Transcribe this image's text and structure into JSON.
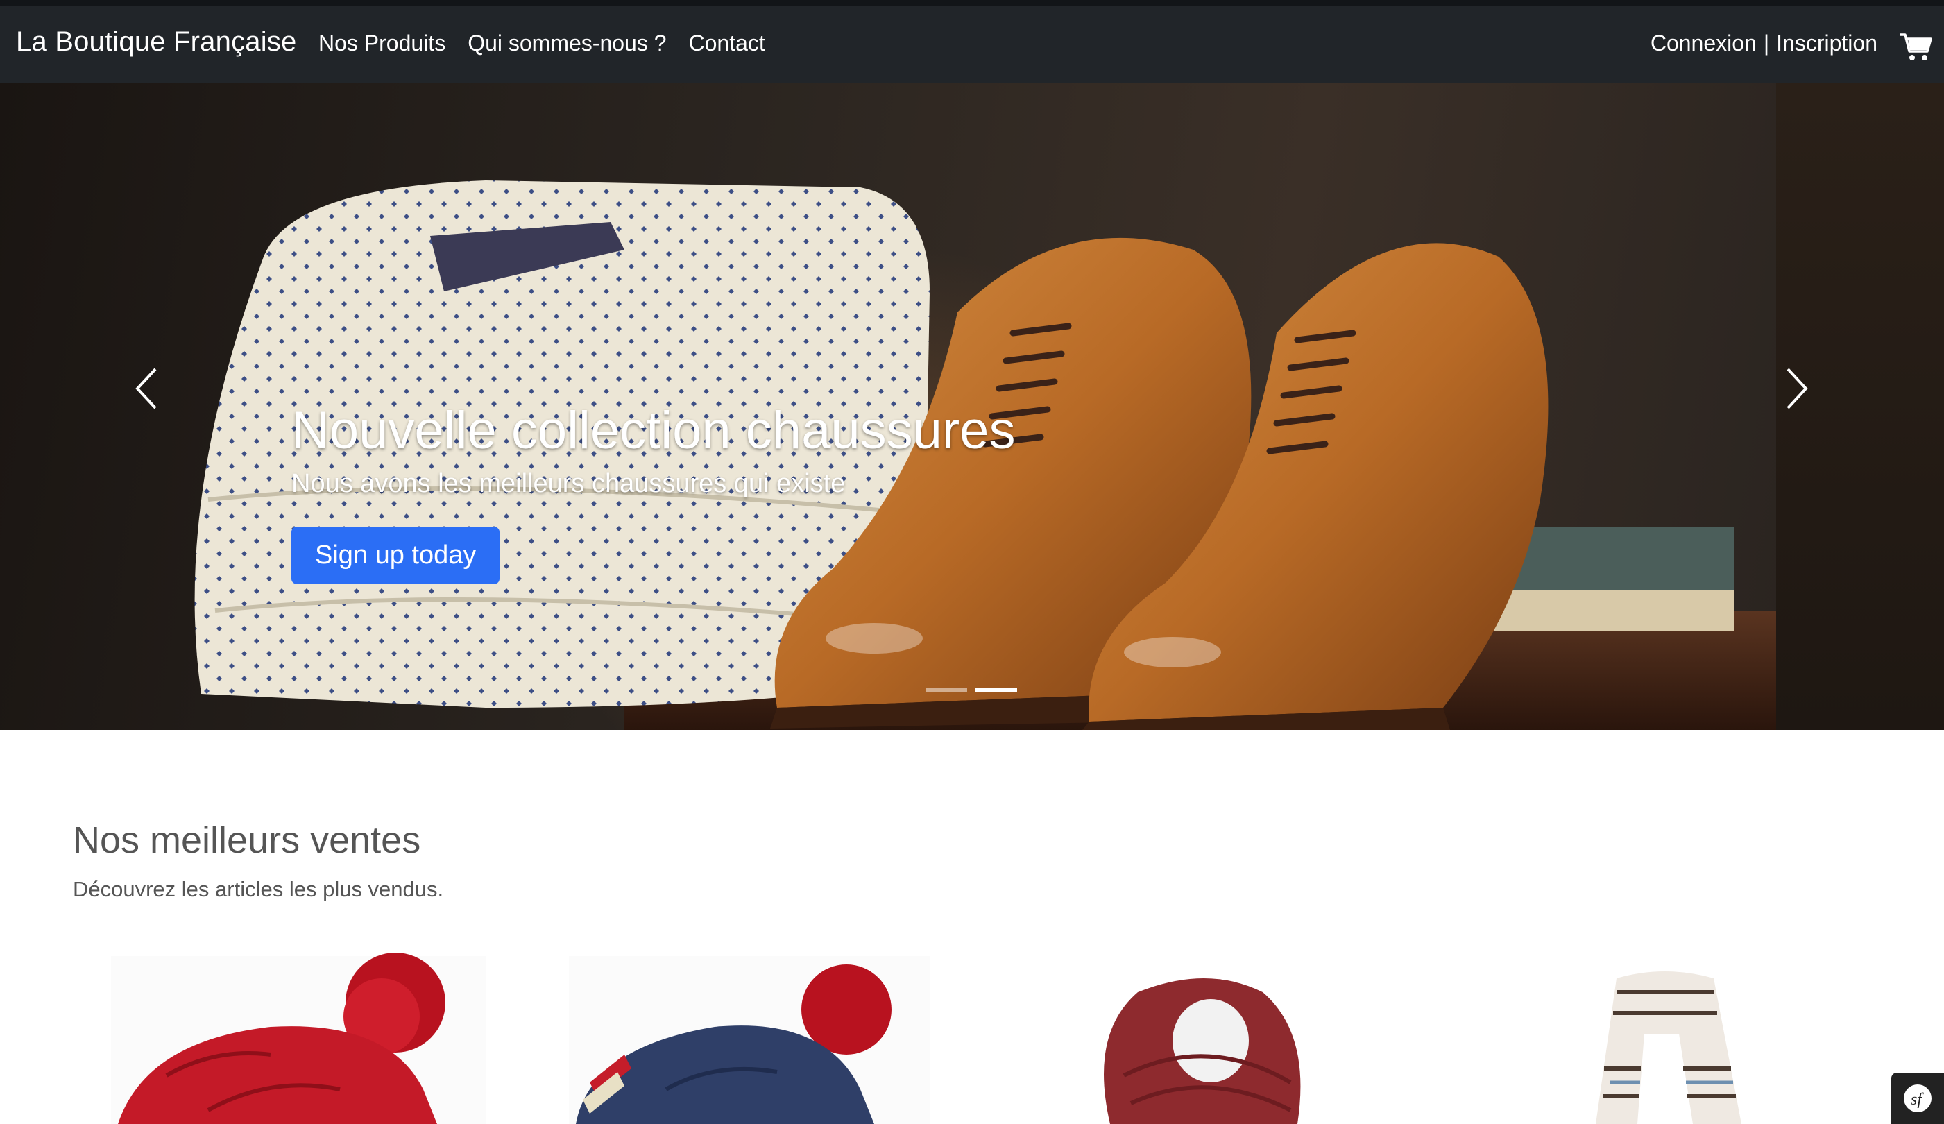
{
  "navbar": {
    "brand": "La Boutique Française",
    "links": [
      "Nos Produits",
      "Qui sommes-nous ?",
      "Contact"
    ],
    "login": "Connexion",
    "separator": "|",
    "register": "Inscription",
    "cart_icon": "cart-icon"
  },
  "hero": {
    "title": "Nouvelle collection chaussures",
    "subtitle": "Nous avons les meilleurs chaussures qui existe",
    "button_label": "Sign up today",
    "slides": 2,
    "active_slide": 2,
    "prev_icon": "chevron-left-icon",
    "next_icon": "chevron-right-icon"
  },
  "bestsellers": {
    "title": "Nos meilleurs ventes",
    "subtitle": "Découvrez les articles les plus vendus.",
    "products": [
      {
        "icon": "red-beanie-image"
      },
      {
        "icon": "blue-beanie-image"
      },
      {
        "icon": "burgundy-scarf-image"
      },
      {
        "icon": "striped-scarf-image"
      }
    ]
  },
  "colors": {
    "navbar_bg": "#212529",
    "primary_button": "#2b6ef5",
    "section_text": "#555555"
  }
}
